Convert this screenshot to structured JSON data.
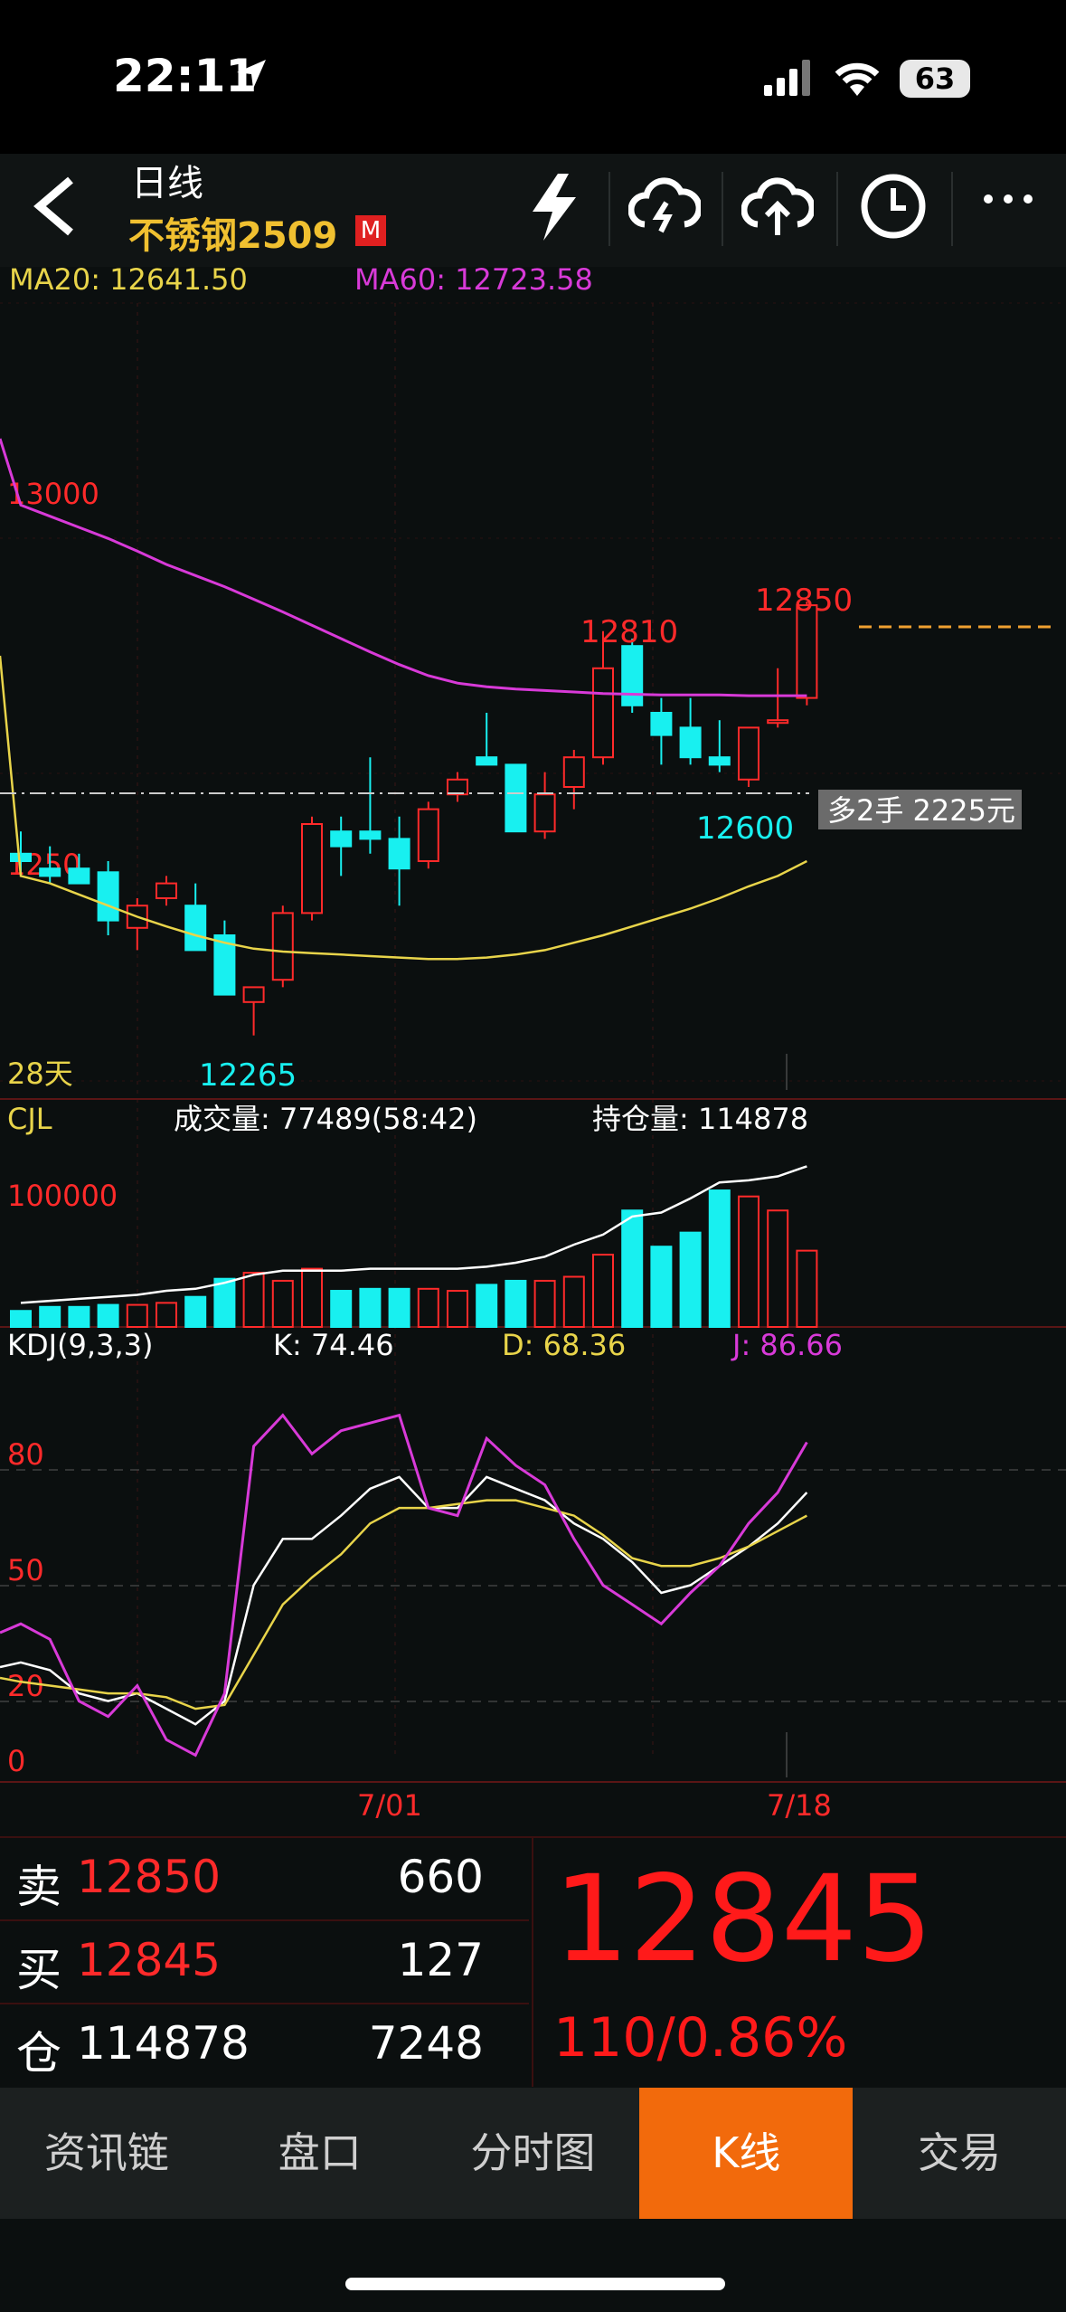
{
  "status_bar": {
    "time": "22:11",
    "battery": "63"
  },
  "header": {
    "title": "日线",
    "symbol": "不锈钢2509",
    "badge": "M"
  },
  "main_chart": {
    "ma20_label": "MA20: 12641.50",
    "ma60_label": "MA60: 12723.58",
    "price_levels": [
      "13000",
      "1250"
    ],
    "high_marker": "12850",
    "mid_high_marker": "12810",
    "low_marker": "12600",
    "min_marker": "12265",
    "period_label": "28天",
    "position_tag": "多2手 2225元"
  },
  "volume_panel": {
    "title": "CJL",
    "volume_label": "成交量: 77489(58:42)",
    "oi_label": "持仓量: 114878",
    "axis_label": "100000"
  },
  "kdj_panel": {
    "title": "KDJ(9,3,3)",
    "k_label": "K: 74.46",
    "d_label": "D: 68.36",
    "j_label": "J: 86.66",
    "levels": [
      "80",
      "50",
      "20",
      "0"
    ]
  },
  "x_axis": {
    "labels": [
      "7/01",
      "7/18"
    ]
  },
  "quote": {
    "sell_label": "卖",
    "sell_price": "12850",
    "sell_volume": "660",
    "buy_label": "买",
    "buy_price": "12845",
    "buy_volume": "127",
    "oi_label": "仓",
    "oi_value": "114878",
    "oi_change": "7248",
    "last_price": "12845",
    "change": "110/0.86%"
  },
  "tabs": [
    {
      "label": "资讯链",
      "active": false
    },
    {
      "label": "盘口",
      "active": false
    },
    {
      "label": "分时图",
      "active": false
    },
    {
      "label": "K线",
      "active": true
    },
    {
      "label": "交易",
      "active": false
    }
  ],
  "colors": {
    "up": "#ff2a2a",
    "down": "#18f0f0",
    "ma20": "#e8d44a",
    "ma60": "#d83ad8",
    "accent": "#f26a0c"
  },
  "chart_data": {
    "type": "candlestick",
    "candles": [
      {
        "o": 12510,
        "h": 12540,
        "l": 12480,
        "c": 12500
      },
      {
        "o": 12490,
        "h": 12520,
        "l": 12470,
        "c": 12480
      },
      {
        "o": 12490,
        "h": 12510,
        "l": 12470,
        "c": 12470
      },
      {
        "o": 12485,
        "h": 12500,
        "l": 12400,
        "c": 12420
      },
      {
        "o": 12410,
        "h": 12450,
        "l": 12380,
        "c": 12440
      },
      {
        "o": 12450,
        "h": 12480,
        "l": 12440,
        "c": 12470
      },
      {
        "o": 12440,
        "h": 12470,
        "l": 12380,
        "c": 12380
      },
      {
        "o": 12400,
        "h": 12420,
        "l": 12320,
        "c": 12320
      },
      {
        "o": 12310,
        "h": 12330,
        "l": 12265,
        "c": 12330
      },
      {
        "o": 12340,
        "h": 12440,
        "l": 12330,
        "c": 12430
      },
      {
        "o": 12430,
        "h": 12560,
        "l": 12420,
        "c": 12550
      },
      {
        "o": 12540,
        "h": 12560,
        "l": 12480,
        "c": 12520
      },
      {
        "o": 12540,
        "h": 12640,
        "l": 12510,
        "c": 12530
      },
      {
        "o": 12530,
        "h": 12560,
        "l": 12440,
        "c": 12490
      },
      {
        "o": 12500,
        "h": 12580,
        "l": 12490,
        "c": 12570
      },
      {
        "o": 12590,
        "h": 12620,
        "l": 12580,
        "c": 12610
      },
      {
        "o": 12640,
        "h": 12700,
        "l": 12630,
        "c": 12630
      },
      {
        "o": 12630,
        "h": 12620,
        "l": 12540,
        "c": 12540
      },
      {
        "o": 12540,
        "h": 12620,
        "l": 12530,
        "c": 12590
      },
      {
        "o": 12600,
        "h": 12650,
        "l": 12570,
        "c": 12640
      },
      {
        "o": 12640,
        "h": 12810,
        "l": 12630,
        "c": 12760
      },
      {
        "o": 12790,
        "h": 12800,
        "l": 12700,
        "c": 12710
      },
      {
        "o": 12700,
        "h": 12720,
        "l": 12630,
        "c": 12670
      },
      {
        "o": 12680,
        "h": 12720,
        "l": 12630,
        "c": 12640
      },
      {
        "o": 12640,
        "h": 12690,
        "l": 12620,
        "c": 12630
      },
      {
        "o": 12610,
        "h": 12680,
        "l": 12600,
        "c": 12680
      },
      {
        "o": 12690,
        "h": 12760,
        "l": 12680,
        "c": 12690
      },
      {
        "o": 12720,
        "h": 12850,
        "l": 12710,
        "c": 12845
      }
    ],
    "ma20": [
      12480,
      12470,
      12455,
      12440,
      12425,
      12412,
      12400,
      12390,
      12382,
      12378,
      12376,
      12374,
      12372,
      12370,
      12368,
      12368,
      12370,
      12374,
      12380,
      12390,
      12400,
      12412,
      12424,
      12436,
      12450,
      12466,
      12480,
      12500
    ],
    "ma60": [
      12980,
      12965,
      12950,
      12935,
      12918,
      12900,
      12885,
      12870,
      12853,
      12836,
      12818,
      12800,
      12782,
      12765,
      12750,
      12740,
      12735,
      12732,
      12730,
      12728,
      12726,
      12725,
      12724,
      12724,
      12724,
      12723,
      12723,
      12723
    ],
    "volume": [
      8,
      10,
      10,
      11,
      11,
      12,
      15,
      24,
      27,
      23,
      29,
      18,
      19,
      19,
      19,
      18,
      21,
      23,
      23,
      25,
      36,
      58,
      40,
      47,
      68,
      65,
      58,
      38
    ],
    "open_interest": [
      12,
      13,
      14,
      15,
      16,
      18,
      19,
      22,
      26,
      28,
      28,
      28,
      29,
      29,
      29,
      29,
      30,
      32,
      35,
      41,
      46,
      55,
      57,
      64,
      72,
      73,
      75,
      80
    ],
    "k": [
      30,
      28,
      22,
      20,
      22,
      18,
      14,
      20,
      50,
      62,
      62,
      68,
      75,
      78,
      70,
      70,
      78,
      75,
      72,
      66,
      62,
      56,
      48,
      50,
      55,
      60,
      66,
      74
    ],
    "d": [
      25,
      24,
      23,
      22,
      22,
      21,
      18,
      19,
      32,
      45,
      52,
      58,
      66,
      70,
      70,
      71,
      72,
      72,
      70,
      68,
      63,
      57,
      55,
      55,
      57,
      60,
      64,
      68
    ],
    "j": [
      40,
      36,
      20,
      16,
      24,
      10,
      6,
      22,
      86,
      94,
      84,
      90,
      92,
      94,
      70,
      68,
      88,
      81,
      76,
      62,
      50,
      45,
      40,
      48,
      55,
      66,
      74,
      87
    ],
    "x_labels": [
      "7/01",
      "7/18"
    ]
  }
}
